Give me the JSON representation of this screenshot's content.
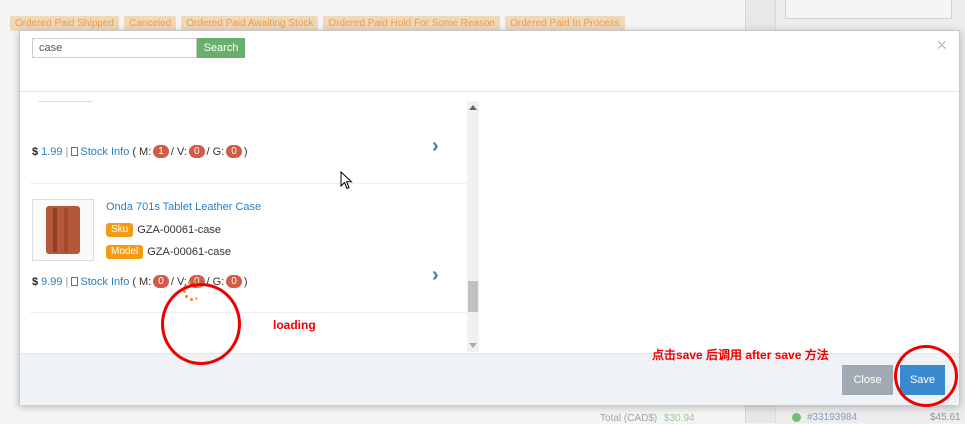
{
  "background": {
    "chips": [
      "Ordered Paid Shipped",
      "Canceled",
      "Ordered Paid Awaiting Stock",
      "Ordered Paid Hold For Some Reason",
      "Ordered Paid In Process"
    ],
    "footer_total_label": "Total (CAD$)",
    "footer_total_value": "$30.94",
    "order_id": "#33193984",
    "order_price": "$45.61"
  },
  "modal": {
    "search": {
      "value": "case",
      "button_label": "Search"
    },
    "close_icon": "×",
    "items": [
      {
        "price": "1.99",
        "stock_label": "Stock Info",
        "m": "1",
        "v": "0",
        "g": "0"
      },
      {
        "name": "Onda 701s Tablet Leather Case",
        "sku_label": "Sku",
        "sku": "GZA-00061-case",
        "model_label": "Model",
        "model": "GZA-00061-case",
        "price": "9.99",
        "stock_label": "Stock Info",
        "m": "0",
        "v": "0",
        "g": "0"
      }
    ],
    "footer": {
      "close_label": "Close",
      "save_label": "Save"
    }
  },
  "annotations": {
    "loading": "loading",
    "save_note": "点击save 后调用 after save 方法"
  },
  "colors": {
    "accent": "#2a7ec1",
    "annotation": "#e00000",
    "badge": "#d15b47",
    "tag": "#f39c12"
  }
}
